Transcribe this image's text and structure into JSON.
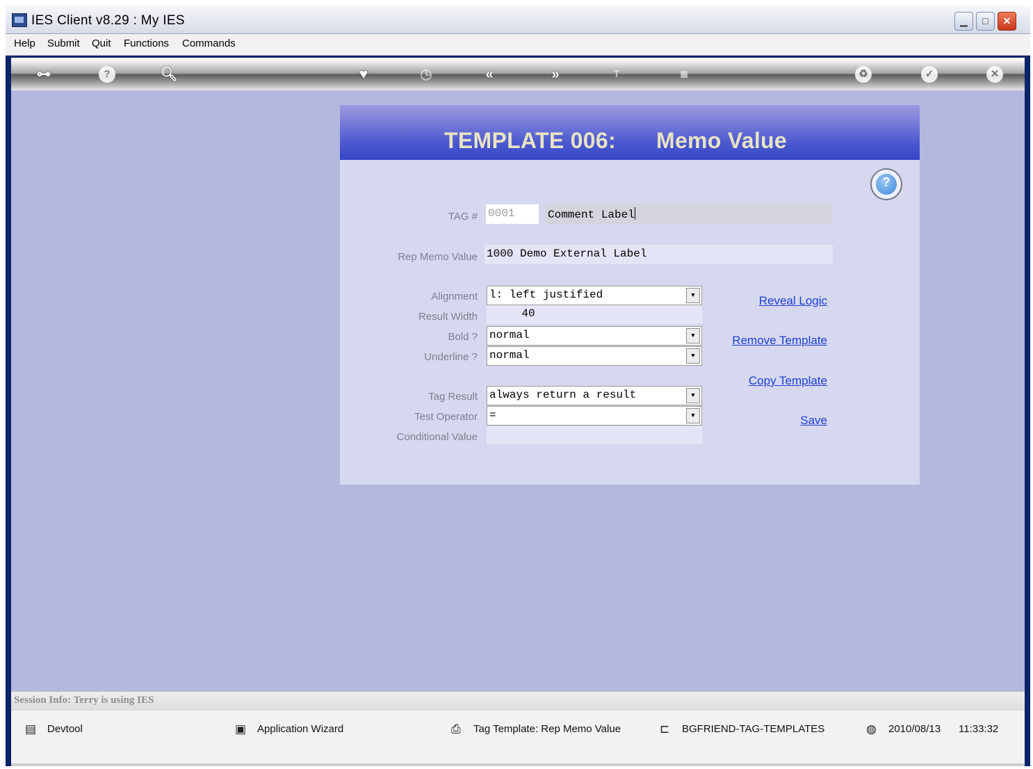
{
  "window": {
    "title": "IES Client v8.29 : My IES"
  },
  "menu": [
    "Help",
    "Submit",
    "Quit",
    "Functions",
    "Commands"
  ],
  "toolbar": {
    "icons": [
      "key-icon",
      "help-icon",
      "search-icon",
      "heart-icon",
      "clock-icon",
      "back-icon",
      "forward-icon",
      "text-icon",
      "chip-icon",
      "recycle-icon",
      "check-icon",
      "close-icon"
    ]
  },
  "form": {
    "title_left": "TEMPLATE 006:",
    "title_right": "Memo Value",
    "tag_label": "TAG #",
    "tag_number": "0001",
    "tag_name": "Comment Label",
    "rep_memo_label": "Rep Memo Value",
    "rep_memo_value": "1000 Demo External Label",
    "alignment_label": "Alignment",
    "alignment_value": "l: left justified",
    "result_width_label": "Result Width",
    "result_width_value": "40",
    "bold_label": "Bold ?",
    "bold_value": "normal",
    "underline_label": "Underline ?",
    "underline_value": "normal",
    "tag_result_label": "Tag Result",
    "tag_result_value": "always return a result",
    "test_operator_label": "Test Operator",
    "test_operator_value": "=",
    "conditional_value_label": "Conditional Value",
    "conditional_value": ""
  },
  "links": {
    "reveal_logic": "Reveal Logic",
    "remove_template": "Remove Template",
    "copy_template": "Copy Template",
    "save": "Save"
  },
  "status": {
    "session_info": "Session Info: Terry is using IES"
  },
  "taskbar": {
    "devtool": "Devtool",
    "app_wizard": "Application Wizard",
    "tag_template": "Tag Template: Rep Memo Value",
    "bgfriend": "BGFRIEND-TAG-TEMPLATES",
    "date": "2010/08/13",
    "time": "11:33:32"
  }
}
